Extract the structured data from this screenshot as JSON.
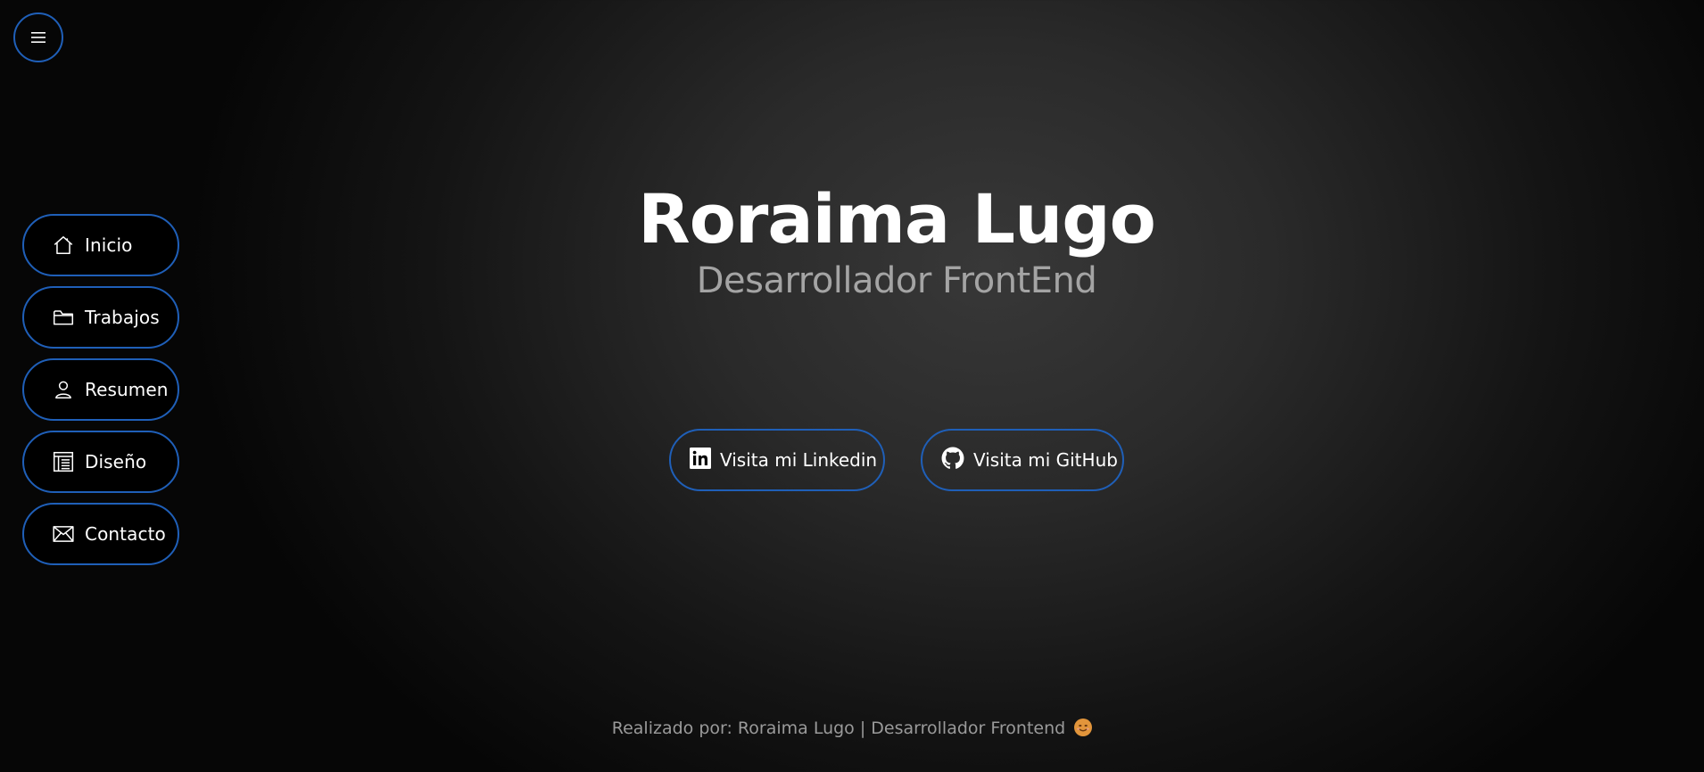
{
  "menu": {
    "icon": "hamburger-icon"
  },
  "sidebar": {
    "items": [
      {
        "label": "Inicio",
        "icon": "home-icon"
      },
      {
        "label": "Trabajos",
        "icon": "folder-icon"
      },
      {
        "label": "Resumen",
        "icon": "person-icon"
      },
      {
        "label": "Diseño",
        "icon": "layout-icon"
      },
      {
        "label": "Contacto",
        "icon": "envelope-icon"
      }
    ]
  },
  "hero": {
    "title": "Roraima Lugo",
    "subtitle": "Desarrollador FrontEnd"
  },
  "social": {
    "linkedin_label": "Visita mi Linkedin",
    "github_label": "Visita mi GitHub"
  },
  "footer": {
    "text": "Realizado por: Roraima Lugo | Desarrollador Frontend",
    "emoji": "smiling-face-icon"
  },
  "colors": {
    "accent_border": "#1f5fb8",
    "subtitle": "#a4a4a4",
    "footer_text": "#9a9a9a"
  }
}
